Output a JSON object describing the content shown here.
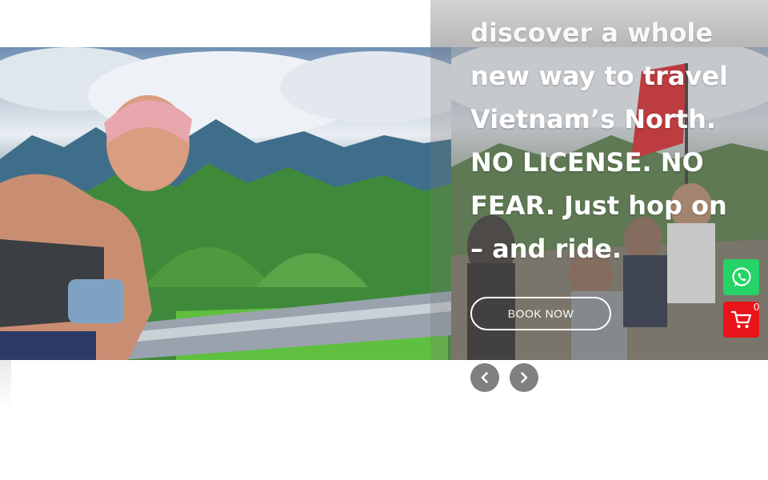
{
  "hero": {
    "headline_lines": [
      "discover a whole",
      "new way to travel",
      "Vietnam’s North.",
      "NO LICENSE. NO",
      "FEAR. Just hop on",
      "– and ride."
    ],
    "book_button": "BOOK NOW"
  },
  "slider": {
    "prev_icon": "chevron-left-icon",
    "next_icon": "chevron-right-icon"
  },
  "floating": {
    "whatsapp_icon": "whatsapp-icon",
    "cart_icon": "cart-icon",
    "cart_count": "0"
  },
  "colors": {
    "whatsapp": "#25d366",
    "cart": "#e8151b",
    "arrow_bg": "#808080",
    "text": "#ffffff"
  }
}
